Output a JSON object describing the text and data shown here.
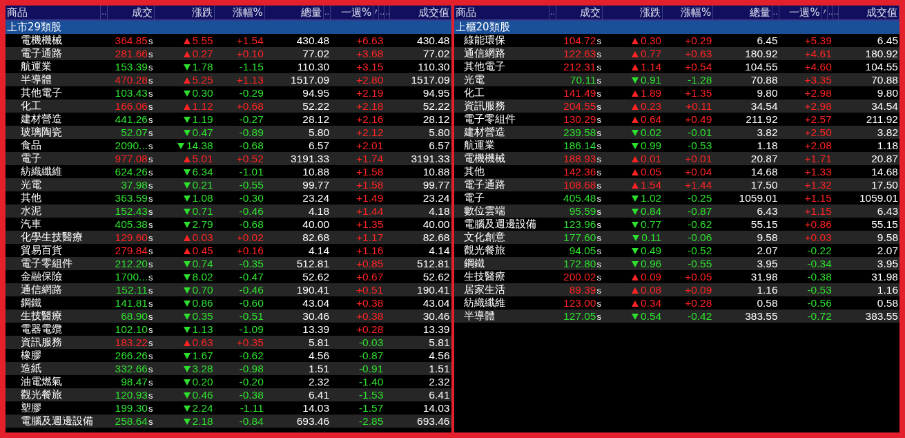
{
  "panels": [
    {
      "header": [
        {
          "kind": "text",
          "label": "商品"
        },
        {
          "kind": "handle",
          "label": ".."
        },
        {
          "kind": "text",
          "label": "成交"
        },
        {
          "kind": "text",
          "label": "漲跌"
        },
        {
          "kind": "text",
          "label": "漲幅%"
        },
        {
          "kind": "text",
          "label": "總量"
        },
        {
          "kind": "handle",
          "label": ".."
        },
        {
          "kind": "text",
          "label": "一週%"
        },
        {
          "kind": "sort"
        },
        {
          "kind": "handle",
          "label": ".."
        },
        {
          "kind": "handle",
          "label": ".."
        },
        {
          "kind": "text",
          "label": "成交值"
        }
      ],
      "group": "上市29類股",
      "rows": [
        {
          "name": "電機機械",
          "price": "364.85",
          "flag": "s",
          "rising": true,
          "change": "5.55",
          "pct": "+1.54",
          "volume": "430.48",
          "week": "+6.63",
          "week_rising": true,
          "value": "430.48"
        },
        {
          "name": "電子通路",
          "price": "281.66",
          "flag": "s",
          "rising": true,
          "change": "0.27",
          "pct": "+0.10",
          "volume": "77.02",
          "week": "+3.68",
          "week_rising": true,
          "value": "77.02"
        },
        {
          "name": "航運業",
          "price": "153.39",
          "flag": "s",
          "rising": false,
          "change": "1.78",
          "pct": "-1.15",
          "volume": "110.30",
          "week": "+3.15",
          "week_rising": true,
          "value": "110.30"
        },
        {
          "name": "半導體",
          "price": "470.28",
          "flag": "s",
          "rising": true,
          "change": "5.25",
          "pct": "+1.13",
          "volume": "1517.09",
          "week": "+2.80",
          "week_rising": true,
          "value": "1517.09"
        },
        {
          "name": "其他電子",
          "price": "103.43",
          "flag": "s",
          "rising": false,
          "change": "0.30",
          "pct": "-0.29",
          "volume": "94.95",
          "week": "+2.19",
          "week_rising": true,
          "value": "94.95"
        },
        {
          "name": "化工",
          "price": "166.06",
          "flag": "s",
          "rising": true,
          "change": "1.12",
          "pct": "+0.68",
          "volume": "52.22",
          "week": "+2.18",
          "week_rising": true,
          "value": "52.22"
        },
        {
          "name": "建材營造",
          "price": "441.26",
          "flag": "s",
          "rising": false,
          "change": "1.19",
          "pct": "-0.27",
          "volume": "28.12",
          "week": "+2.16",
          "week_rising": true,
          "value": "28.12"
        },
        {
          "name": "玻璃陶瓷",
          "price": "52.07",
          "flag": "s",
          "rising": false,
          "change": "0.47",
          "pct": "-0.89",
          "volume": "5.80",
          "week": "+2.12",
          "week_rising": true,
          "value": "5.80"
        },
        {
          "name": "食品",
          "price": "2090...",
          "flag": "s",
          "rising": false,
          "change": "14.38",
          "pct": "-0.68",
          "volume": "6.57",
          "week": "+2.01",
          "week_rising": true,
          "value": "6.57"
        },
        {
          "name": "電子",
          "price": "977.08",
          "flag": "s",
          "rising": true,
          "change": "5.01",
          "pct": "+0.52",
          "volume": "3191.33",
          "week": "+1.74",
          "week_rising": true,
          "value": "3191.33"
        },
        {
          "name": "紡織纖維",
          "price": "624.26",
          "flag": "s",
          "rising": false,
          "change": "6.34",
          "pct": "-1.01",
          "volume": "10.88",
          "week": "+1.58",
          "week_rising": true,
          "value": "10.88"
        },
        {
          "name": "光電",
          "price": "37.98",
          "flag": "s",
          "rising": false,
          "change": "0.21",
          "pct": "-0.55",
          "volume": "99.77",
          "week": "+1.58",
          "week_rising": true,
          "value": "99.77"
        },
        {
          "name": "其他",
          "price": "363.59",
          "flag": "s",
          "rising": false,
          "change": "1.08",
          "pct": "-0.30",
          "volume": "23.24",
          "week": "+1.49",
          "week_rising": true,
          "value": "23.24"
        },
        {
          "name": "水泥",
          "price": "152.43",
          "flag": "s",
          "rising": false,
          "change": "0.71",
          "pct": "-0.46",
          "volume": "4.18",
          "week": "+1.44",
          "week_rising": true,
          "value": "4.18"
        },
        {
          "name": "汽車",
          "price": "405.38",
          "flag": "s",
          "rising": false,
          "change": "2.79",
          "pct": "-0.68",
          "volume": "40.00",
          "week": "+1.35",
          "week_rising": true,
          "value": "40.00"
        },
        {
          "name": "化學生技醫療",
          "price": "129.60",
          "flag": "s",
          "rising": true,
          "change": "0.03",
          "pct": "+0.02",
          "volume": "82.68",
          "week": "+1.17",
          "week_rising": true,
          "value": "82.68"
        },
        {
          "name": "貿易百貨",
          "price": "279.84",
          "flag": "s",
          "rising": true,
          "change": "0.45",
          "pct": "+0.16",
          "volume": "4.14",
          "week": "+1.16",
          "week_rising": true,
          "value": "4.14"
        },
        {
          "name": "電子零組件",
          "price": "212.20",
          "flag": "s",
          "rising": false,
          "change": "0.74",
          "pct": "-0.35",
          "volume": "512.81",
          "week": "+0.85",
          "week_rising": true,
          "value": "512.81"
        },
        {
          "name": "金融保險",
          "price": "1700...",
          "flag": "s",
          "rising": false,
          "change": "8.02",
          "pct": "-0.47",
          "volume": "52.62",
          "week": "+0.67",
          "week_rising": true,
          "value": "52.62"
        },
        {
          "name": "通信網路",
          "price": "152.11",
          "flag": "s",
          "rising": false,
          "change": "0.70",
          "pct": "-0.46",
          "volume": "190.41",
          "week": "+0.51",
          "week_rising": true,
          "value": "190.41"
        },
        {
          "name": "鋼鐵",
          "price": "141.81",
          "flag": "s",
          "rising": false,
          "change": "0.86",
          "pct": "-0.60",
          "volume": "43.04",
          "week": "+0.38",
          "week_rising": true,
          "value": "43.04"
        },
        {
          "name": "生技醫療",
          "price": "68.90",
          "flag": "s",
          "rising": false,
          "change": "0.35",
          "pct": "-0.51",
          "volume": "30.46",
          "week": "+0.38",
          "week_rising": true,
          "value": "30.46"
        },
        {
          "name": "電器電纜",
          "price": "102.10",
          "flag": "s",
          "rising": false,
          "change": "1.13",
          "pct": "-1.09",
          "volume": "13.39",
          "week": "+0.28",
          "week_rising": true,
          "value": "13.39"
        },
        {
          "name": "資訊服務",
          "price": "183.22",
          "flag": "s",
          "rising": true,
          "change": "0.63",
          "pct": "+0.35",
          "volume": "5.81",
          "week": "-0.03",
          "week_rising": false,
          "value": "5.81"
        },
        {
          "name": "橡膠",
          "price": "266.26",
          "flag": "s",
          "rising": false,
          "change": "1.67",
          "pct": "-0.62",
          "volume": "4.56",
          "week": "-0.87",
          "week_rising": false,
          "value": "4.56"
        },
        {
          "name": "造紙",
          "price": "332.66",
          "flag": "s",
          "rising": false,
          "change": "3.28",
          "pct": "-0.98",
          "volume": "1.51",
          "week": "-0.91",
          "week_rising": false,
          "value": "1.51"
        },
        {
          "name": "油電燃氣",
          "price": "98.47",
          "flag": "s",
          "rising": false,
          "change": "0.20",
          "pct": "-0.20",
          "volume": "2.32",
          "week": "-1.40",
          "week_rising": false,
          "value": "2.32"
        },
        {
          "name": "觀光餐旅",
          "price": "120.93",
          "flag": "s",
          "rising": false,
          "change": "0.46",
          "pct": "-0.38",
          "volume": "6.41",
          "week": "-1.53",
          "week_rising": false,
          "value": "6.41"
        },
        {
          "name": "塑膠",
          "price": "199.30",
          "flag": "s",
          "rising": false,
          "change": "2.24",
          "pct": "-1.11",
          "volume": "14.03",
          "week": "-1.57",
          "week_rising": false,
          "value": "14.03"
        },
        {
          "name": "電腦及週邊設備",
          "price": "258.64",
          "flag": "s",
          "rising": false,
          "change": "2.18",
          "pct": "-0.84",
          "volume": "693.46",
          "week": "-2.85",
          "week_rising": false,
          "value": "693.46"
        }
      ]
    },
    {
      "header": [
        {
          "kind": "text",
          "label": "商品"
        },
        {
          "kind": "handle",
          "label": ".."
        },
        {
          "kind": "text",
          "label": "成交"
        },
        {
          "kind": "text",
          "label": "漲跌"
        },
        {
          "kind": "text",
          "label": "漲幅%"
        },
        {
          "kind": "text",
          "label": "總量"
        },
        {
          "kind": "handle",
          "label": ".."
        },
        {
          "kind": "text",
          "label": "一週%"
        },
        {
          "kind": "sort"
        },
        {
          "kind": "handle",
          "label": ".."
        },
        {
          "kind": "handle",
          "label": ".."
        },
        {
          "kind": "text",
          "label": "成交值"
        }
      ],
      "group": "上櫃20類股",
      "rows": [
        {
          "name": "綠能環保",
          "price": "104.72",
          "flag": "s",
          "rising": true,
          "change": "0.30",
          "pct": "+0.29",
          "volume": "6.45",
          "week": "+5.39",
          "week_rising": true,
          "value": "6.45"
        },
        {
          "name": "通信網路",
          "price": "122.63",
          "flag": "s",
          "rising": true,
          "change": "0.77",
          "pct": "+0.63",
          "volume": "180.92",
          "week": "+4.61",
          "week_rising": true,
          "value": "180.92"
        },
        {
          "name": "其他電子",
          "price": "212.31",
          "flag": "s",
          "rising": true,
          "change": "1.14",
          "pct": "+0.54",
          "volume": "104.55",
          "week": "+4.60",
          "week_rising": true,
          "value": "104.55"
        },
        {
          "name": "光電",
          "price": "70.11",
          "flag": "s",
          "rising": false,
          "change": "0.91",
          "pct": "-1.28",
          "volume": "70.88",
          "week": "+3.35",
          "week_rising": true,
          "value": "70.88"
        },
        {
          "name": "化工",
          "price": "141.49",
          "flag": "s",
          "rising": true,
          "change": "1.89",
          "pct": "+1.35",
          "volume": "9.80",
          "week": "+2.98",
          "week_rising": true,
          "value": "9.80"
        },
        {
          "name": "資訊服務",
          "price": "204.55",
          "flag": "s",
          "rising": true,
          "change": "0.23",
          "pct": "+0.11",
          "volume": "34.54",
          "week": "+2.98",
          "week_rising": true,
          "value": "34.54"
        },
        {
          "name": "電子零組件",
          "price": "130.29",
          "flag": "s",
          "rising": true,
          "change": "0.64",
          "pct": "+0.49",
          "volume": "211.92",
          "week": "+2.57",
          "week_rising": true,
          "value": "211.92"
        },
        {
          "name": "建材營造",
          "price": "239.58",
          "flag": "s",
          "rising": false,
          "change": "0.02",
          "pct": "-0.01",
          "volume": "3.82",
          "week": "+2.50",
          "week_rising": true,
          "value": "3.82"
        },
        {
          "name": "航運業",
          "price": "186.14",
          "flag": "s",
          "rising": false,
          "change": "0.99",
          "pct": "-0.53",
          "volume": "1.18",
          "week": "+2.08",
          "week_rising": true,
          "value": "1.18"
        },
        {
          "name": "電機機械",
          "price": "188.93",
          "flag": "s",
          "rising": true,
          "change": "0.01",
          "pct": "+0.01",
          "volume": "20.87",
          "week": "+1.71",
          "week_rising": true,
          "value": "20.87"
        },
        {
          "name": "其他",
          "price": "142.36",
          "flag": "s",
          "rising": true,
          "change": "0.05",
          "pct": "+0.04",
          "volume": "14.68",
          "week": "+1.33",
          "week_rising": true,
          "value": "14.68"
        },
        {
          "name": "電子通路",
          "price": "108.68",
          "flag": "s",
          "rising": true,
          "change": "1.54",
          "pct": "+1.44",
          "volume": "17.50",
          "week": "+1.32",
          "week_rising": true,
          "value": "17.50"
        },
        {
          "name": "電子",
          "price": "405.48",
          "flag": "s",
          "rising": false,
          "change": "1.02",
          "pct": "-0.25",
          "volume": "1059.01",
          "week": "+1.15",
          "week_rising": true,
          "value": "1059.01"
        },
        {
          "name": "數位雲端",
          "price": "95.59",
          "flag": "s",
          "rising": false,
          "change": "0.84",
          "pct": "-0.87",
          "volume": "6.43",
          "week": "+1.15",
          "week_rising": true,
          "value": "6.43"
        },
        {
          "name": "電腦及週邊設備",
          "price": "123.96",
          "flag": "s",
          "rising": false,
          "change": "0.77",
          "pct": "-0.62",
          "volume": "55.15",
          "week": "+0.86",
          "week_rising": true,
          "value": "55.15"
        },
        {
          "name": "文化創意",
          "price": "177.60",
          "flag": "s",
          "rising": false,
          "change": "0.11",
          "pct": "-0.06",
          "volume": "9.58",
          "week": "+0.03",
          "week_rising": true,
          "value": "9.58"
        },
        {
          "name": "觀光餐旅",
          "price": "94.05",
          "flag": "s",
          "rising": false,
          "change": "0.49",
          "pct": "-0.52",
          "volume": "2.07",
          "week": "-0.22",
          "week_rising": false,
          "value": "2.07"
        },
        {
          "name": "鋼鐵",
          "price": "172.80",
          "flag": "s",
          "rising": false,
          "change": "0.96",
          "pct": "-0.55",
          "volume": "3.95",
          "week": "-0.34",
          "week_rising": false,
          "value": "3.95"
        },
        {
          "name": "生技醫療",
          "price": "200.02",
          "flag": "s",
          "rising": true,
          "change": "0.09",
          "pct": "+0.05",
          "volume": "31.98",
          "week": "-0.38",
          "week_rising": false,
          "value": "31.98"
        },
        {
          "name": "居家生活",
          "price": "89.39",
          "flag": "s",
          "rising": true,
          "change": "0.08",
          "pct": "+0.09",
          "volume": "1.16",
          "week": "-0.53",
          "week_rising": false,
          "value": "1.16"
        },
        {
          "name": "紡織纖維",
          "price": "123.00",
          "flag": "s",
          "rising": true,
          "change": "0.34",
          "pct": "+0.28",
          "volume": "0.58",
          "week": "-0.56",
          "week_rising": false,
          "value": "0.58"
        },
        {
          "name": "半導體",
          "price": "127.05",
          "flag": "s",
          "rising": false,
          "change": "0.54",
          "pct": "-0.42",
          "volume": "383.55",
          "week": "-0.72",
          "week_rising": false,
          "value": "383.55"
        }
      ]
    }
  ]
}
